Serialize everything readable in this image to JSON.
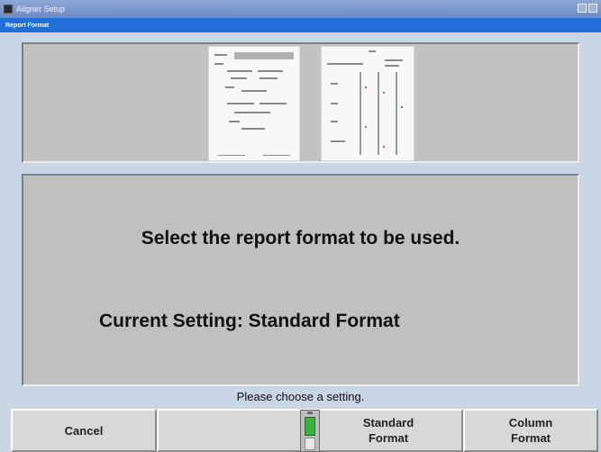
{
  "window": {
    "title": "Aligner Setup",
    "subtitle": "Report Format"
  },
  "main": {
    "message_line1": "Select the report format to be used.",
    "message_line2": "Current Setting: Standard Format"
  },
  "status": {
    "text": "Please choose a setting."
  },
  "softkeys": [
    {
      "label": "Cancel"
    },
    {
      "label": ""
    },
    {
      "label": "Standard\nFormat"
    },
    {
      "label": "Column\nFormat"
    }
  ],
  "battery": {
    "charge_fraction": 0.6,
    "color": "#3ab23a"
  },
  "colors": {
    "subtitle_bar": "#1f6fd6",
    "background": "#c9d6e6"
  }
}
